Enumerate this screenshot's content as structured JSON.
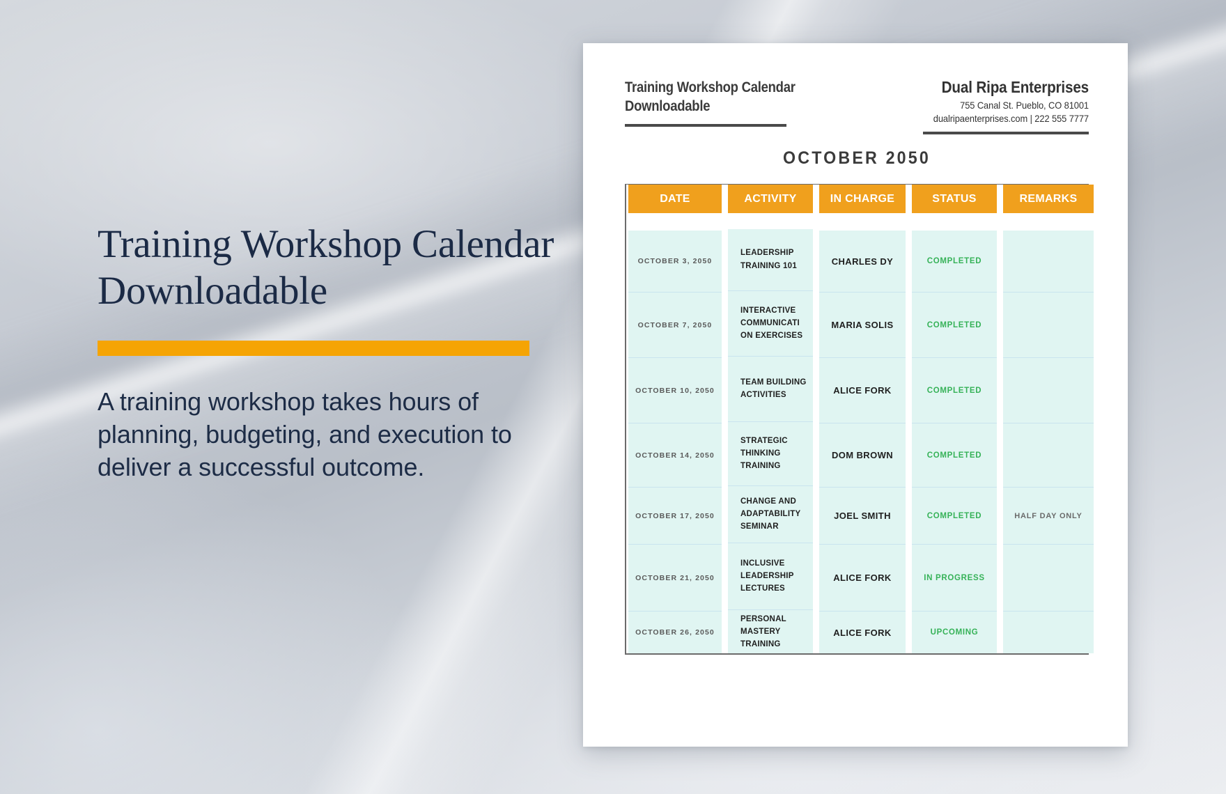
{
  "promo": {
    "title": "Training Workshop Calendar Downloadable",
    "body": "A training workshop takes hours of planning, budgeting, and execution to deliver a successful outcome.",
    "accent_color": "#f5a404"
  },
  "document": {
    "header": {
      "title": "Training Workshop Calendar\nDownloadable",
      "org_name": "Dual Ripa Enterprises",
      "org_address": "755 Canal St. Pueblo, CO 81001",
      "org_contact": "dualripaenterprises.com | 222 555 7777"
    },
    "month_title": "OCTOBER 2050",
    "columns": [
      {
        "key": "date",
        "label": "DATE"
      },
      {
        "key": "activity",
        "label": "ACTIVITY"
      },
      {
        "key": "charge",
        "label": "IN CHARGE"
      },
      {
        "key": "status",
        "label": "STATUS"
      },
      {
        "key": "remarks",
        "label": "REMARKS"
      }
    ],
    "rows": [
      {
        "date": "OCTOBER 3, 2050",
        "activity": "LEADERSHIP TRAINING 101",
        "charge": "CHARLES DY",
        "status": "COMPLETED",
        "remarks": ""
      },
      {
        "date": "OCTOBER 7, 2050",
        "activity": "INTERACTIVE COMMUNICATI ON EXERCISES",
        "charge": "MARIA SOLIS",
        "status": "COMPLETED",
        "remarks": ""
      },
      {
        "date": "OCTOBER 10, 2050",
        "activity": "TEAM BUILDING ACTIVITIES",
        "charge": "ALICE FORK",
        "status": "COMPLETED",
        "remarks": ""
      },
      {
        "date": "OCTOBER 14, 2050",
        "activity": "STRATEGIC THINKING TRAINING",
        "charge": "DOM BROWN",
        "status": "COMPLETED",
        "remarks": ""
      },
      {
        "date": "OCTOBER 17, 2050",
        "activity": "CHANGE AND ADAPTABILITY SEMINAR",
        "charge": "JOEL SMITH",
        "status": "COMPLETED",
        "remarks": "HALF DAY ONLY"
      },
      {
        "date": "OCTOBER 21, 2050",
        "activity": "INCLUSIVE LEADERSHIP LECTURES",
        "charge": "ALICE FORK",
        "status": "IN PROGRESS",
        "remarks": ""
      },
      {
        "date": "OCTOBER 26, 2050",
        "activity": "PERSONAL MASTERY TRAINING",
        "charge": "ALICE FORK",
        "status": "UPCOMING",
        "remarks": ""
      }
    ],
    "colors": {
      "header_orange": "#f0a01d",
      "cell_mint": "#e0f5f2",
      "status_green": "#36b258",
      "rule_gray": "#4a4a4a"
    }
  }
}
